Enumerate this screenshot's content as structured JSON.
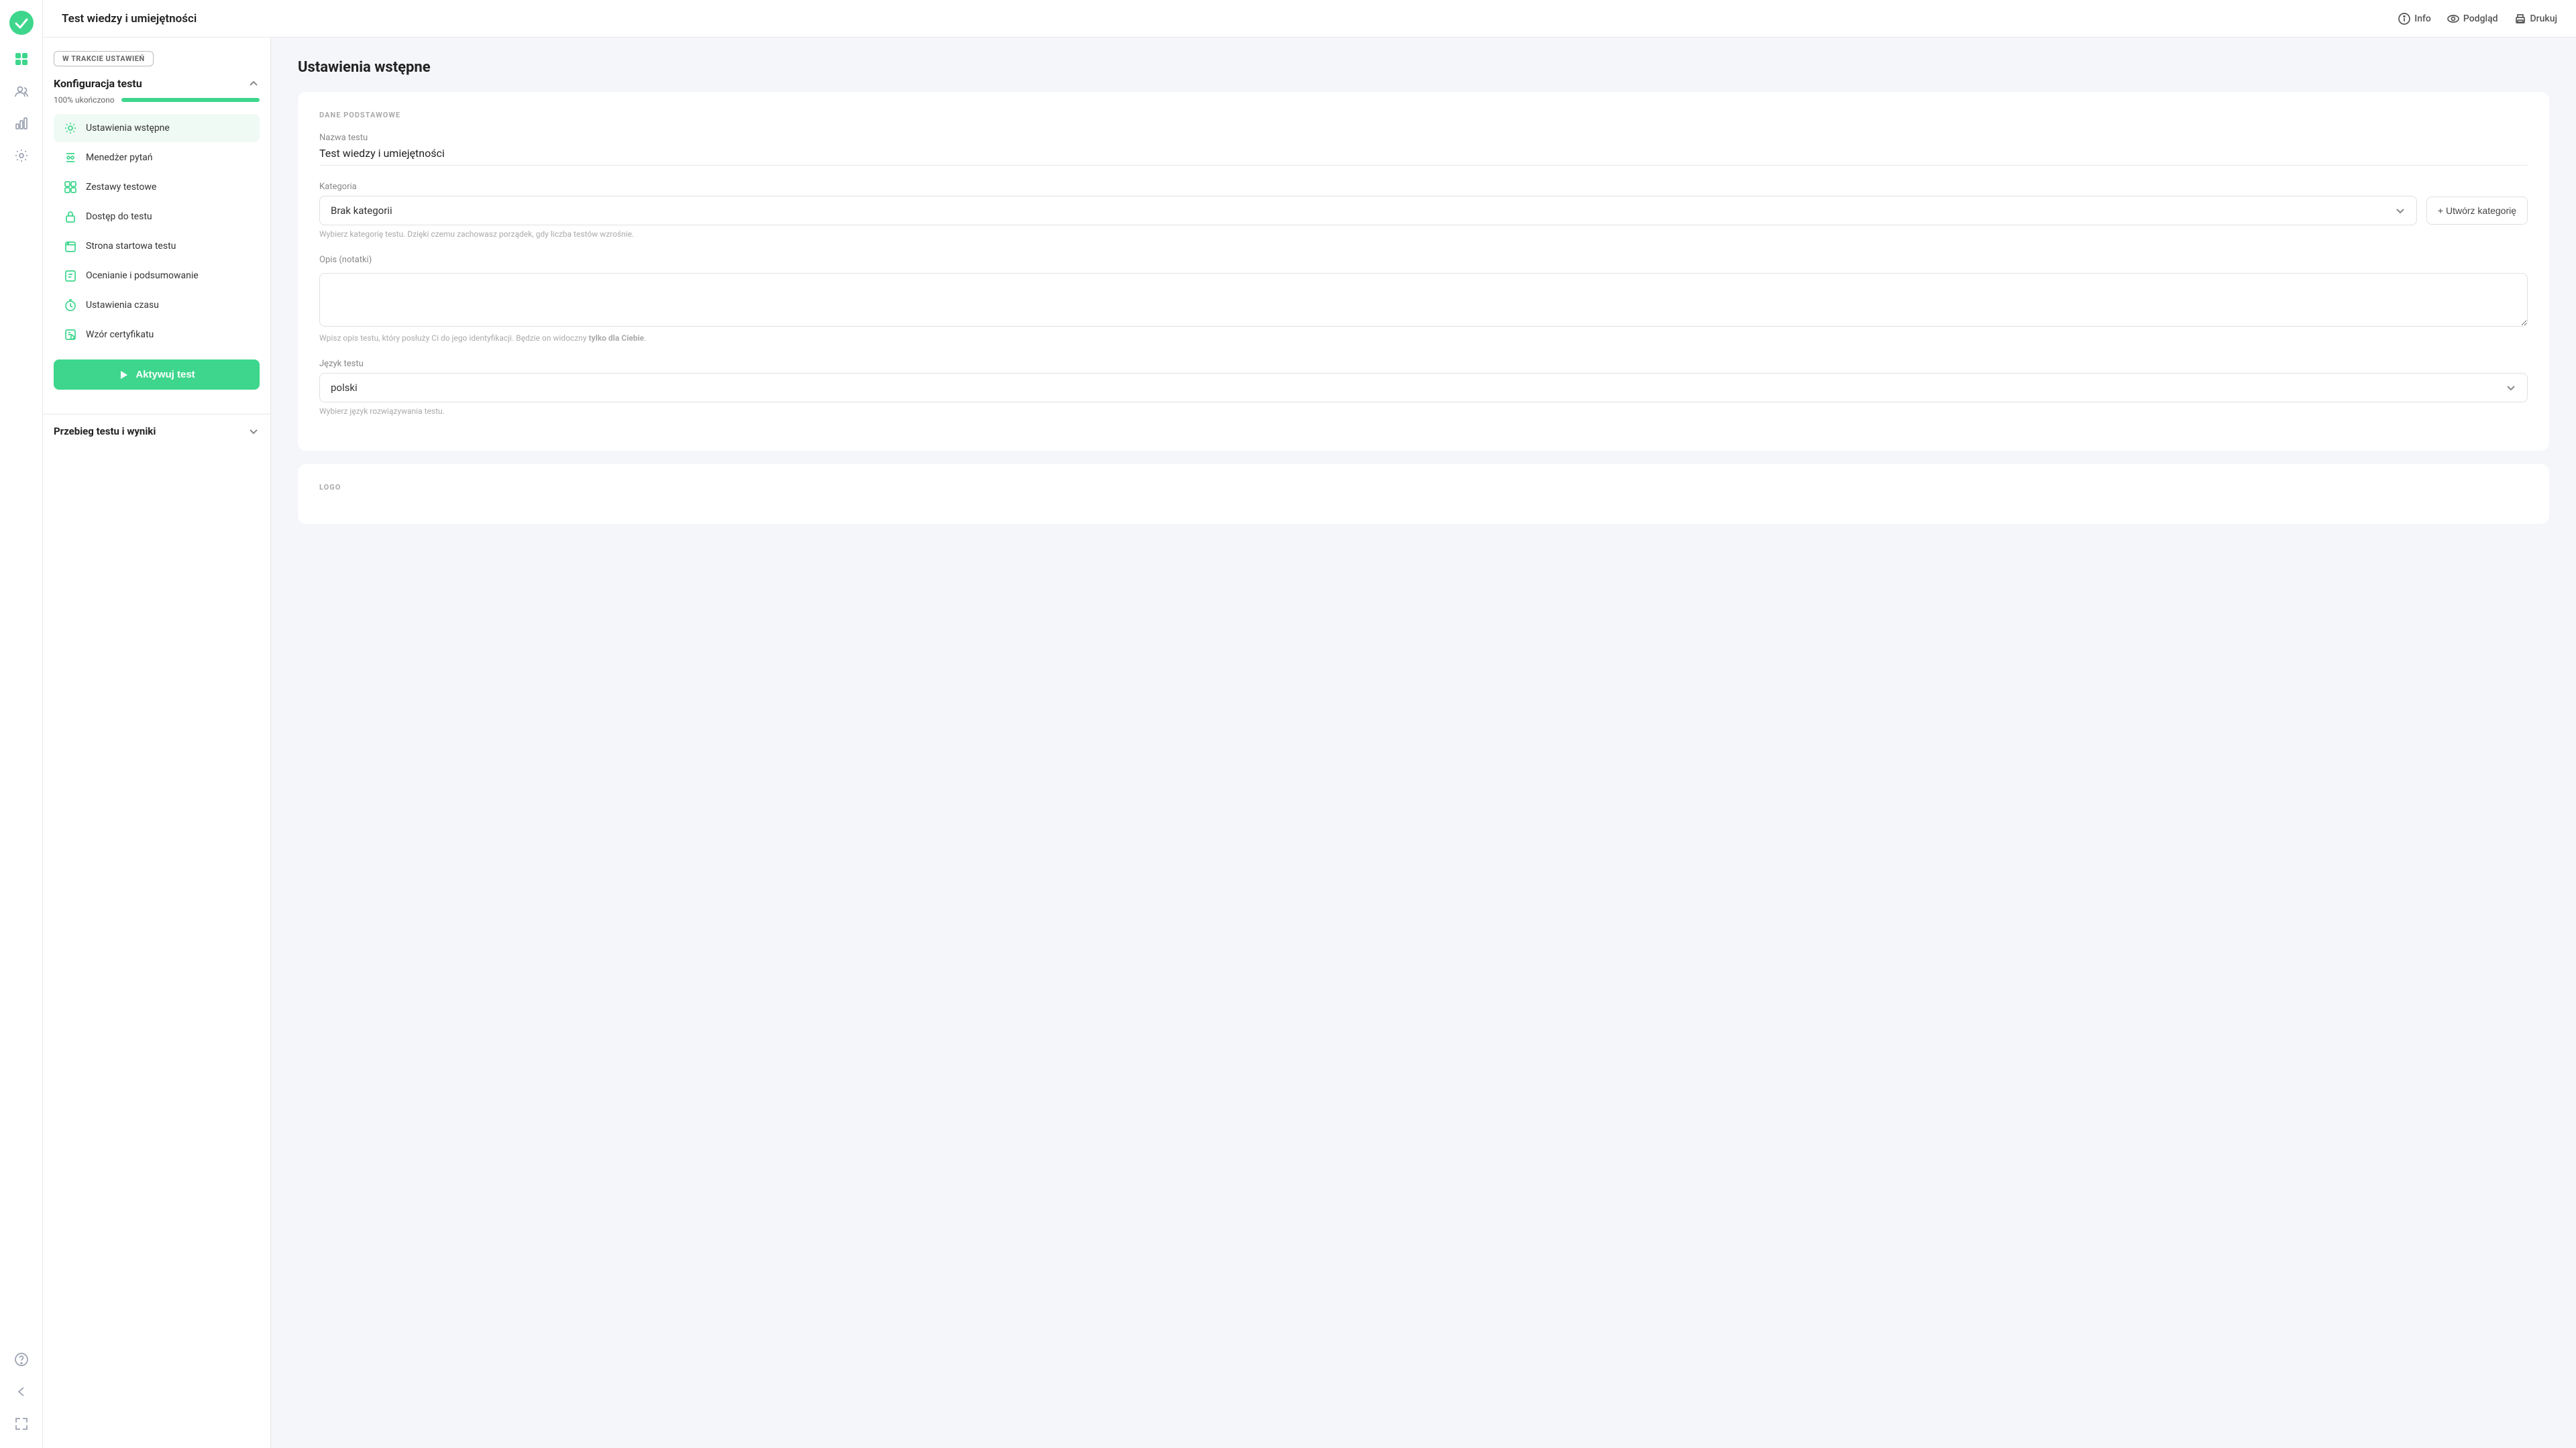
{
  "app": {
    "title": "Test wiedzy i umiejętności"
  },
  "header": {
    "info_label": "Info",
    "preview_label": "Podgląd",
    "print_label": "Drukuj"
  },
  "sidebar": {
    "status_badge": "W TRAKCIE USTAWIEŃ",
    "config_section_title": "Konfiguracja testu",
    "progress_text": "100% ukończono",
    "progress_value": 100,
    "nav_items": [
      {
        "id": "ustawienia-wstepne",
        "label": "Ustawienia wstępne",
        "active": true
      },
      {
        "id": "menedzer-pytan",
        "label": "Menedżer pytań",
        "active": false
      },
      {
        "id": "zestawy-testowe",
        "label": "Zestawy testowe",
        "active": false
      },
      {
        "id": "dostep-do-testu",
        "label": "Dostęp do testu",
        "active": false
      },
      {
        "id": "strona-startowa-testu",
        "label": "Strona startowa testu",
        "active": false
      },
      {
        "id": "ocenianie-i-podsumowanie",
        "label": "Ocenianie i podsumowanie",
        "active": false
      },
      {
        "id": "ustawienia-czasu",
        "label": "Ustawienia czasu",
        "active": false
      },
      {
        "id": "wzor-certyfikatu",
        "label": "Wzór certyfikatu",
        "active": false
      }
    ],
    "activate_btn_label": "Aktywuj test",
    "results_section_title": "Przebieg testu i wyniki"
  },
  "main": {
    "page_title": "Ustawienia wstępne",
    "card1": {
      "section_label": "DANE PODSTAWOWE",
      "name_field_label": "Nazwa testu",
      "name_field_value": "Test wiedzy i umiejętności",
      "category_label": "Kategoria",
      "category_value": "Brak kategorii",
      "category_hint": "Wybierz kategorię testu. Dzięki czemu zachowasz porządek, gdy liczba testów wzrośnie.",
      "create_category_label": "+ Utwórz kategorię",
      "notes_label": "Opis (notatki)",
      "notes_hint_prefix": "Wpisz opis testu, który posłuży Ci do jego identyfikacji. Będzie on widoczny ",
      "notes_hint_bold": "tylko dla Ciebie",
      "notes_hint_suffix": ".",
      "language_label": "Język testu",
      "language_value": "polski",
      "language_hint": "Wybierz język rozwiązywania testu."
    },
    "card2": {
      "section_label": "LOGO"
    }
  }
}
